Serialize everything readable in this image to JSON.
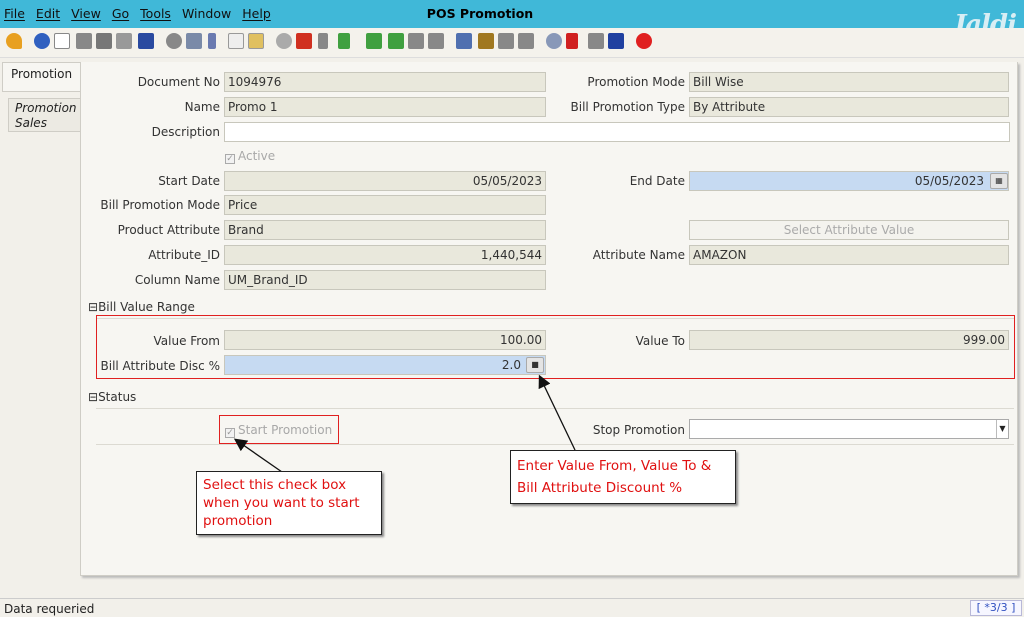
{
  "menu": [
    "File",
    "Edit",
    "View",
    "Go",
    "Tools",
    "Window",
    "Help"
  ],
  "window_title": "POS Promotion",
  "logo_text": "Jaldi",
  "tabs": {
    "promotion": "Promotion",
    "promotion_sales_line1": "Promotion",
    "promotion_sales_line2": "Sales"
  },
  "form": {
    "document_no": {
      "label": "Document No",
      "value": "1094976"
    },
    "name": {
      "label": "Name",
      "value": "Promo 1"
    },
    "description": {
      "label": "Description",
      "value": ""
    },
    "active": {
      "label": "Active",
      "checked": true
    },
    "start_date": {
      "label": "Start Date",
      "value": "05/05/2023"
    },
    "bill_promotion_mode": {
      "label": "Bill Promotion Mode",
      "value": "Price"
    },
    "product_attribute": {
      "label": "Product Attribute",
      "value": "Brand"
    },
    "attribute_id": {
      "label": "Attribute_ID",
      "value": "1,440,544"
    },
    "column_name": {
      "label": "Column Name",
      "value": "UM_Brand_ID"
    },
    "promotion_mode": {
      "label": "Promotion Mode",
      "value": "Bill Wise"
    },
    "bill_promotion_type": {
      "label": "Bill Promotion Type",
      "value": "By Attribute"
    },
    "end_date": {
      "label": "End Date",
      "value": "05/05/2023"
    },
    "select_attribute_value": "Select Attribute Value",
    "attribute_name": {
      "label": "Attribute Name",
      "value": "AMAZON"
    }
  },
  "bill_value_range": {
    "section": "Bill Value Range",
    "value_from": {
      "label": "Value From",
      "value": "100.00"
    },
    "value_to": {
      "label": "Value To",
      "value": "999.00"
    },
    "bill_attribute_disc": {
      "label": "Bill Attribute Disc %",
      "value": "2.0"
    }
  },
  "status": {
    "section": "Status",
    "start_promotion": {
      "label": "Start Promotion",
      "checked": true
    },
    "stop_promotion": {
      "label": "Stop Promotion",
      "value": ""
    }
  },
  "annotations": {
    "checkbox_note": [
      "Select this check box",
      "when you want to start",
      "promotion"
    ],
    "range_note": [
      "Enter Value From, Value To &",
      "Bill Attribute Discount %"
    ]
  },
  "statusbar": {
    "message": "Data requeried",
    "record": "[ *3/3 ]"
  },
  "colors": {
    "titlebar": "#40b8d8",
    "annotation": "#e01010",
    "highlight_field": "#c6daf2"
  }
}
